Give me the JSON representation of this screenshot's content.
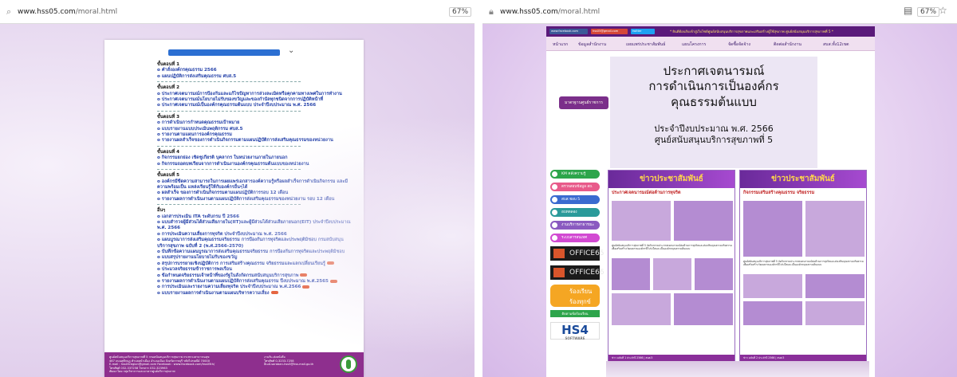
{
  "left": {
    "browser": {
      "url_host": "www.hss05.com",
      "url_path": "/moral.html",
      "zoom": "67%"
    },
    "sections": [
      {
        "title": "ขั้นตอนที่ 1",
        "items": [
          "o คำสั่งองค์กรคุณธรรม 2566",
          "o แผนปฏิบัติการส่งเสริมคุณธรรม ศบส.5"
        ]
      },
      {
        "title": "ขั้นตอนที่ 2",
        "items": [
          "o ประกาศเจตนารมณ์การป้องกันและแก้ไขปัญหาการล่วงละเมิดหรือคุกคามทางเพศในการทำงาน",
          "o ประกาศเจตนารมณ์นโยบายไม่รับของขวัญและของกำนัลทุกชนิดจากการปฏิบัติหน้าที่",
          "o ประกาศเจตนารมณ์เป็นองค์กรคุณธรรมต้นแบบ ประจำปีงบประมาณ พ.ศ. 2566"
        ]
      },
      {
        "title": "ขั้นตอนที่ 3",
        "items": [
          "o การดำเนินการกำหนดคุณธรรมเป้าหมาย",
          "o แบบรายงานแบบประเมินพฤติกรรม ศบส.5",
          "o รายงานตามแผนการองค์กรคุณธรรม",
          "o รายงานผลสำเร็จของการดำเนินกิจกรรมตามแผนปฏิบัติการส่งเสริมคุณธรรมของหน่วยงาน"
        ]
      },
      {
        "title": "ขั้นตอนที่ 4",
        "items": [
          "o กิจกรรมยกย่อง เชิดชูเกียรติ บุคลากร ในหน่วยงานภายในภายนอก",
          "o กิจกรรมถอดบทเรียนจากการดำเนินงานองค์กรคุณธรรมต้นแบบของหน่วยงาน"
        ]
      },
      {
        "title": "ขั้นตอนที่ 5",
        "items": [
          "o องค์กรมีขีดความสามารถในการเผยแพร่เอกสารองค์ความรู้หรือผลสำเร็จการดำเนินกิจกรรม และมีความพร้อมเป็น แหล่งเรียนรู้ให้กับองค์กรอื่นๆได้",
          "o ผลสำเร็จ ของการดำเนินกิจกรรมตามแผนปฏิบัติการรอบ 12 เดือน",
          "o รายงานผลการดำเนินงานตามแผนปฏิบัติการส่งเสริมคุณธรรมของหน่วยงาน รอบ 12 เดือน"
        ]
      },
      {
        "title": "อื่นๆ",
        "items": [
          "o เอกสารประเมิน ITA ระดับกรม ปี 2566",
          "o แบบสำรวจผู้มีส่วนได้ส่วนเสียภายใน(IIT)และผู้มีส่วนได้ส่วนเสียภายนอก(EIT) ประจำปีงบประมาณ พ.ศ. 2566",
          "o การประเมินความเสี่ยงการทุจริต ประจำปีงบประมาณ พ.ศ. 2566",
          "o แผนบูรณาการส่งเสริมคุณธรรมจริยธรรม การป้องกันการทุจริตและประพฤติมิชอบ กรมสนับสนุนบริการสุขภาพ ฉบับที่ 2 (พ.ศ.2566-2570)",
          "o บันทึกข้อความแผนบูรณาการส่งเสริมคุณธรรมจริยธรรม การป้องกันการทุจริตและประพฤติมิชอบ",
          "o แบบสรุปรายงานนโยบายไม่รับของขวัญ",
          "o สรุปการบรรยายเชิงปฏิบัติการ การเสริมสร้างคุณธรรม จริยธรรมและแลกเปลี่ยนเรียนรู้",
          "o ประมวลจริยธรรมข้าราชการพลเรือน",
          "o ข้อกำหนดจริยธรรมเจ้าหน้าที่ของรัฐในสังกัดกรมสนับสนุนบริการสุขภาพ",
          "o รายงานผลการดำเนินงานตามแผนปฏิบัติการส่งเสริมคุณธรรม ปีงบประมาณ พ.ศ.2565",
          "o การประเมินและรายงานความเสี่ยงทุจริต ประจำปีงบประมาณ พ.ศ.2566",
          "o แบบรายงานผลการดำเนินงานตามแผนบริหารความเสี่ยง"
        ]
      }
    ],
    "new_flag_rows": [
      [
        5,
        6
      ],
      [
        5,
        8
      ],
      [
        5,
        9
      ],
      [
        5,
        10
      ],
      [
        5,
        11
      ]
    ],
    "footer": {
      "l1": "ศูนย์สนับสนุนบริการสุขภาพที่ 5 กรมสนับสนุนบริการสุขภาพ กระทรวงสาธารณสุข",
      "l2": "467 ถนนศุขีกบฏ ตำบลหน้าเมือง อำเภอเมือง จังหวัดราชบุรี รหัสไปรษณีย์ 70000",
      "l3": "E-mail : hss05region@gmail.com Facebook : www.facebook.com/hss05th/",
      "l4": "โทรศัพท์ 032-337258 โทรสาร 032-323963",
      "l5": "พัฒนาโดย กลุ่มวิชาการและอาคารศูนย์บริการสุขภาพ",
      "r1": "งานรับ-ส่งหนังสือ",
      "r2": "โทรศัพท์ 0-3233-7258",
      "r3": "อีเมล์-saraban-hss5@hss.mail.go.th"
    }
  },
  "right": {
    "browser": {
      "url_host": "www.hss05.com",
      "url_path": "/moral.html",
      "zoom": "67%"
    },
    "banner": {
      "marquee": "* ยินดีต้อนรับเข้าสู่เว็บไซต์ศูนย์สนับสนุนบริการสุขภาพและเสริมสร้างผู้ใช้สุขภาพ ศูนย์สนับสนุนบริการสุขภาพที่ 5 *",
      "buttons": [
        "www.facebook.com",
        "hss05@gmail.com",
        "twitter"
      ]
    },
    "menu": [
      "หน้าแรก",
      "ข้อมูลสำนักงาน",
      "เผยแพร่ประชาสัมพันธ์",
      "แผนโครงการ",
      "จัดซื้อจัดจ้าง",
      "ติดต่อสำนักงาน",
      "สบส.ทั้ง12เขต"
    ],
    "hero": {
      "l1": "ประกาศเจตนารมณ์",
      "l2": "การดำเนินการเป็นองค์กร",
      "l3": "คุณธรรมต้นแบบ",
      "l4": "ประจำปีงบประมาณ พ.ศ. 2566",
      "l5": "ศูนย์สนับสนุนบริการสุขภาพที่ 5"
    },
    "side_badge": "มาตรฐานศูนย์ราชการ",
    "sidenav": {
      "pills": [
        "KM คลังความรู้",
        "ตรวจสอบข้อมูล สถ.",
        "สบส.ชอบ 5",
        "อบทดลอง",
        "งานบริการสาธารณะ",
        "ระบบสารสนเทศ"
      ],
      "office1": "OFFICE65",
      "office2": "OFFICE66",
      "complain_l1": "ร้องเรียน",
      "complain_l2": "ร้องทุกข์",
      "green": "ติดตามข้อร้องเรียน",
      "hs4": "HS4",
      "hs4_sub": "SOFTWARE"
    },
    "news1": {
      "head": "ข่าวประชาสัมพันธ์",
      "sub": "ประกาศเจตนารมณ์ต่อต้านการทุจริต",
      "foot": "ข่าว ฉบับที่ 1 ประจำปี 2566 | สบส.5"
    },
    "news2": {
      "head": "ข่าวประชาสัมพันธ์",
      "sub": "กิจกรรมเสริมสร้างคุณธรรม จริยธรรม",
      "foot": "ข่าว ฉบับที่ 2 ประจำปี 2566 | สบส.5"
    },
    "news_body": "ศูนย์สนับสนุนบริการสุขภาพที่ 5 จัดกิจกรรมประกาศเจตนารมณ์ต่อต้านการทุจริตและส่งเสริมคุณธรรมจริยธรรม เพื่อเสริมสร้างวัฒนธรรมองค์กรที่โปร่งใสและเป็นองค์กรคุณธรรมต้นแบบ"
  }
}
